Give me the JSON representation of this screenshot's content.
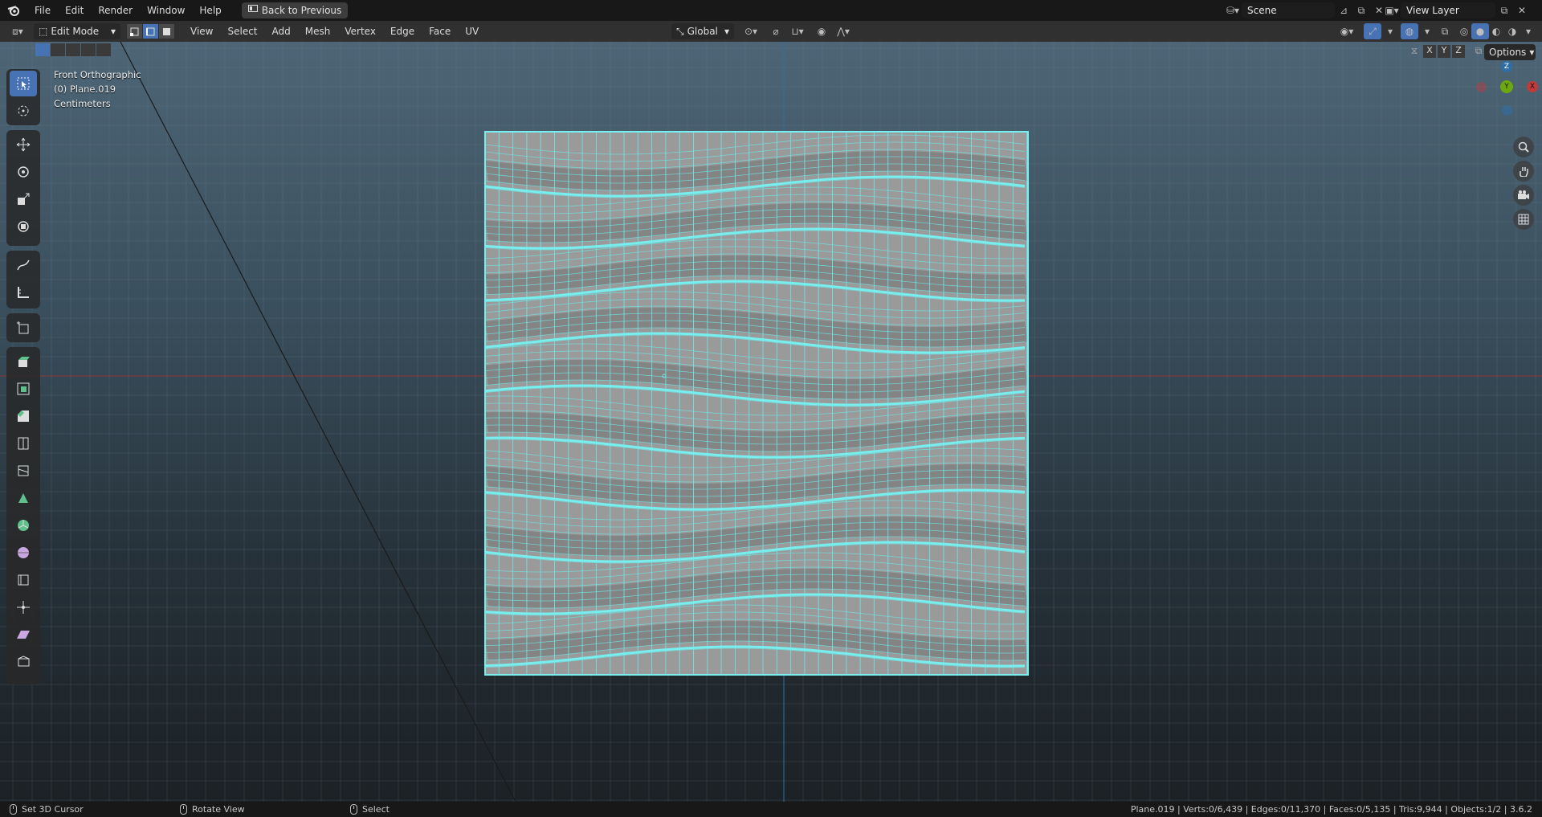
{
  "menubar": {
    "logo": "blender-logo",
    "items": [
      "File",
      "Edit",
      "Render",
      "Window",
      "Help"
    ],
    "back_button": "Back to Previous",
    "scene_name": "Scene",
    "view_layer": "View Layer"
  },
  "header": {
    "mode": "Edit Mode",
    "menus": [
      "View",
      "Select",
      "Add",
      "Mesh",
      "Vertex",
      "Edge",
      "Face",
      "UV"
    ],
    "transform_orientation": "Global",
    "options_label": "Options",
    "axis_x": "X",
    "axis_y": "Y",
    "axis_z": "Z"
  },
  "viewport": {
    "view_name": "Front Orthographic",
    "object_label": "(0) Plane.019",
    "units": "Centimeters",
    "gizmo": {
      "z": "Z",
      "y": "Y",
      "x": "X"
    },
    "accent_color": "#6ee6e6",
    "x_axis_color": "#a53a3a",
    "z_axis_color": "#2f6fa8"
  },
  "tools": [
    "select-box-icon",
    "cursor-icon",
    "move-icon",
    "rotate-icon",
    "scale-icon",
    "transform-icon",
    "annotate-icon",
    "measure-icon",
    "add-cube-icon",
    "extrude-icon",
    "inset-icon",
    "bevel-icon",
    "loop-cut-icon",
    "knife-icon",
    "poly-build-icon",
    "spin-icon",
    "smooth-icon",
    "edge-slide-icon",
    "shrink-fatten-icon",
    "shear-icon",
    "rip-icon"
  ],
  "statusbar": {
    "hint_left": "Set 3D Cursor",
    "hint_middle": "Rotate View",
    "hint_right": "Select",
    "stats": "Plane.019 | Verts:0/6,439 | Edges:0/11,370 | Faces:0/5,135 | Tris:9,944 | Objects:1/2 | 3.6.2"
  }
}
